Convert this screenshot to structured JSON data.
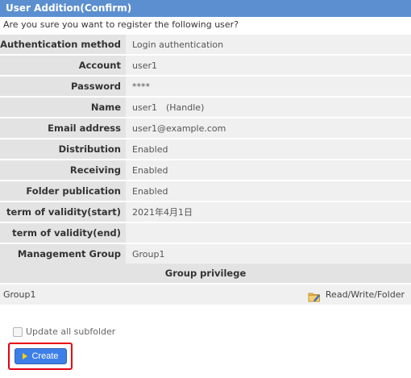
{
  "header": {
    "title": "User Addition(Confirm)",
    "prompt": "Are you sure you want to register the following user?"
  },
  "fields": [
    {
      "label": "Authentication method",
      "value": "Login authentication"
    },
    {
      "label": "Account",
      "value": "user1"
    },
    {
      "label": "Password",
      "value": "****"
    },
    {
      "label": "Name",
      "value": "user1　(Handle)"
    },
    {
      "label": "Email address",
      "value": "user1@example.com"
    },
    {
      "label": "Distribution",
      "value": "Enabled"
    },
    {
      "label": "Receiving",
      "value": "Enabled"
    },
    {
      "label": "Folder publication",
      "value": "Enabled"
    },
    {
      "label": "term of validity(start)",
      "value": "2021年4月1日"
    },
    {
      "label": "term of validity(end)",
      "value": ""
    },
    {
      "label": "Management Group",
      "value": "Group1"
    }
  ],
  "group_privilege": {
    "header": "Group privilege",
    "rows": [
      {
        "group": "Group1",
        "privilege": "Read/Write/Folder",
        "icon": "folder-pencil-icon"
      }
    ]
  },
  "options": {
    "update_subfolder_label": "Update all subfolder",
    "update_subfolder_checked": false
  },
  "actions": {
    "create_label": "Create",
    "accent_color": "#3d7fe8",
    "highlight_color": "#e60012"
  }
}
